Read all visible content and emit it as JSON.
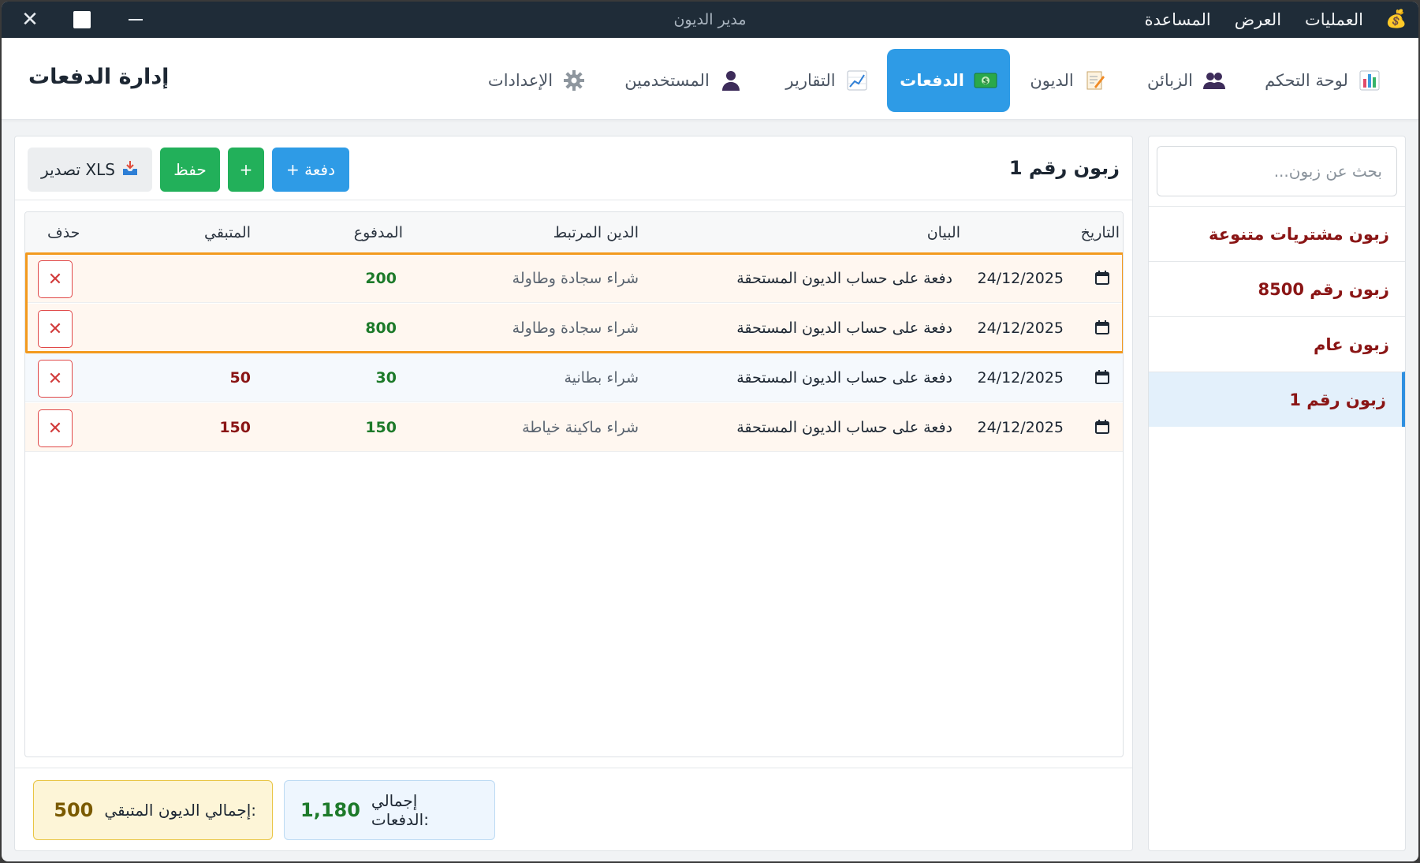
{
  "window": {
    "title": "مدير الديون",
    "menu": [
      "العمليات",
      "العرض",
      "المساعدة"
    ]
  },
  "header": {
    "page_title": "إدارة الدفعات",
    "tabs": [
      {
        "label": "لوحة التحكم",
        "icon": "bar-chart-icon"
      },
      {
        "label": "الزبائن",
        "icon": "users-icon"
      },
      {
        "label": "الديون",
        "icon": "memo-icon"
      },
      {
        "label": "الدفعات",
        "icon": "money-icon",
        "active": true
      },
      {
        "label": "التقارير",
        "icon": "line-chart-icon"
      },
      {
        "label": "المستخدمين",
        "icon": "user-icon"
      },
      {
        "label": "الإعدادات",
        "icon": "gear-icon"
      }
    ]
  },
  "sidebar": {
    "search_placeholder": "بحث عن زبون...",
    "customers": [
      {
        "name": "زبون مشتريات متنوعة"
      },
      {
        "name": "زبون رقم 8500"
      },
      {
        "name": "زبون عام"
      },
      {
        "name": "زبون رقم 1",
        "selected": true
      }
    ]
  },
  "main": {
    "customer_title": "زبون رقم 1",
    "toolbar": {
      "add_payment": "+ دفعة",
      "plus": "+",
      "save": "حفظ",
      "export": "تصدير XLS"
    },
    "table": {
      "headers": {
        "date": "التاريخ",
        "desc": "البيان",
        "debt": "الدين المرتبط",
        "paid": "المدفوع",
        "remaining": "المتبقي",
        "delete": "حذف"
      },
      "rows": [
        {
          "date": "24/12/2025",
          "desc": "دفعة على حساب الديون المستحقة",
          "debt": "شراء سجادة وطاولة",
          "paid": "200",
          "remaining": "",
          "bg": "#fff7f0",
          "highlighted": true
        },
        {
          "date": "24/12/2025",
          "desc": "دفعة على حساب الديون المستحقة",
          "debt": "شراء سجادة وطاولة",
          "paid": "800",
          "remaining": "",
          "bg": "#fff7f0",
          "highlighted": true
        },
        {
          "date": "24/12/2025",
          "desc": "دفعة على حساب الديون المستحقة",
          "debt": "شراء بطانية",
          "paid": "30",
          "remaining": "50",
          "bg": "#f5f9fd"
        },
        {
          "date": "24/12/2025",
          "desc": "دفعة على حساب الديون المستحقة",
          "debt": "شراء ماكينة خياطة",
          "paid": "150",
          "remaining": "150",
          "bg": "#fff7f0"
        }
      ]
    },
    "summary": {
      "payments_label": "إجمالي الدفعات:",
      "payments_value": "1,180",
      "remaining_label": "إجمالي الديون المتبقي:",
      "remaining_value": "500"
    }
  },
  "colors": {
    "accent": "#2e9be6",
    "success": "#22b05a",
    "danger": "#d23c3c",
    "highlight": "#f39a1e"
  }
}
